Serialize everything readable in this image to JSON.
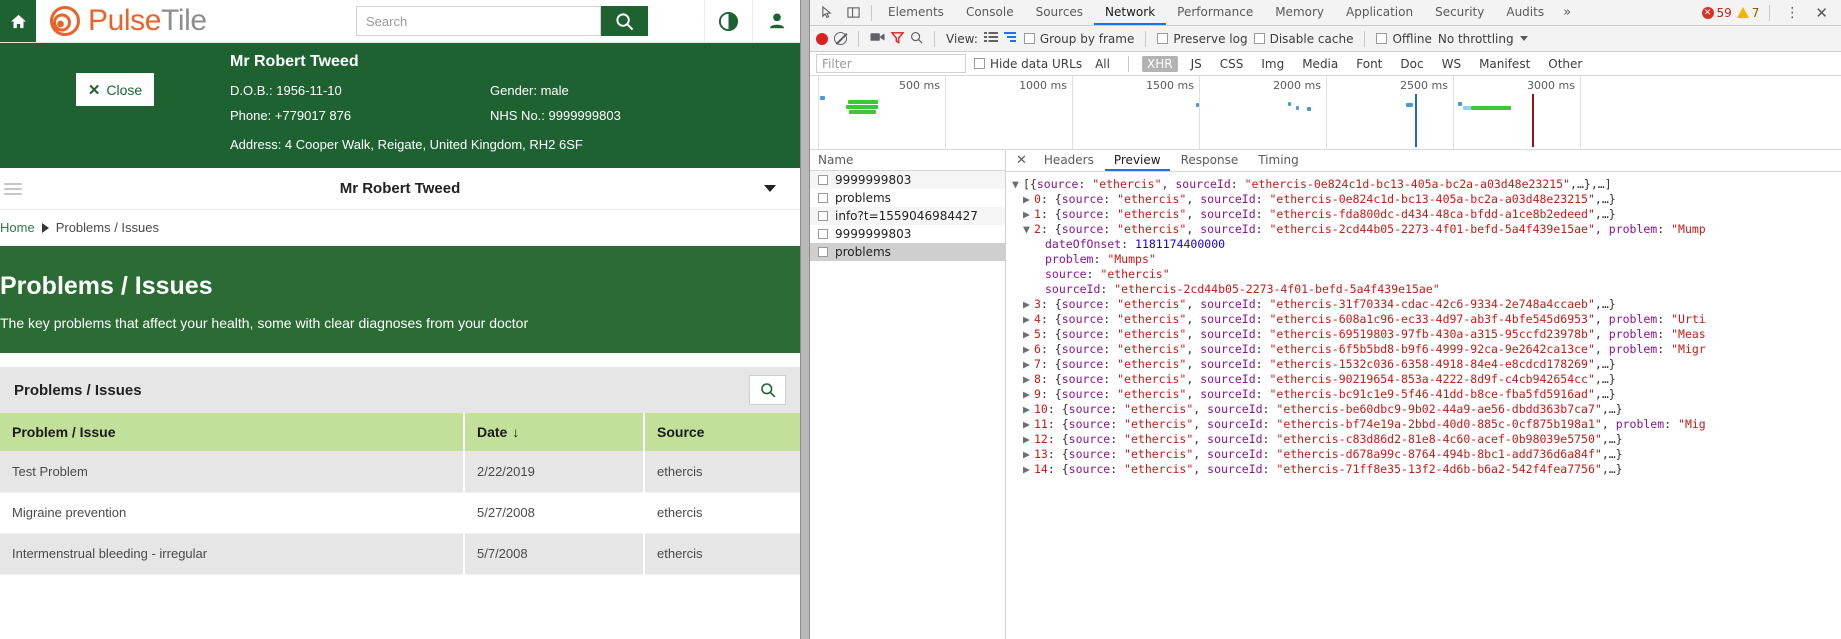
{
  "app": {
    "brand": {
      "pulse": "Pulse",
      "tile": "Tile",
      "home_icon": "home-icon",
      "logo_icon": "pulsetile-logo-icon"
    },
    "search": {
      "placeholder": "Search",
      "value": "",
      "button_icon": "search-icon"
    },
    "topbar_icons": [
      {
        "name": "contrast-icon",
        "glyph": "◑"
      },
      {
        "name": "user-icon",
        "glyph": "person"
      }
    ],
    "patient": {
      "close_label": "Close",
      "close_icon": "close-x-icon",
      "name": "Mr Robert Tweed",
      "dob_label": "D.O.B.: 1956-11-10",
      "phone_label": "Phone: +779017 876",
      "gender_label": "Gender: male",
      "nhs_label": "NHS No.: 9999999803",
      "address_label": "Address: 4 Cooper Walk, Reigate, United Kingdom, RH2 6SF"
    },
    "subbar": {
      "title": "Mr Robert Tweed",
      "menu_icon": "hamburger-icon",
      "caret_icon": "chevron-down-icon"
    },
    "breadcrumb": {
      "home": "Home",
      "current": "Problems / Issues"
    },
    "hero": {
      "title": "Problems / Issues",
      "subtitle": "The key problems that affect your health, some with clear diagnoses from your doctor"
    },
    "panel": {
      "title": "Problems / Issues",
      "search_icon": "search-icon"
    },
    "table": {
      "columns": [
        "Problem / Issue",
        "Date",
        "Source"
      ],
      "sort_column": "Date",
      "sort_arrow": "↓",
      "rows": [
        {
          "problem": "Test Problem",
          "date": "2/22/2019",
          "source": "ethercis"
        },
        {
          "problem": "Migraine prevention",
          "date": "5/27/2008",
          "source": "ethercis"
        },
        {
          "problem": "Intermenstrual bleeding - irregular",
          "date": "5/7/2008",
          "source": "ethercis"
        }
      ]
    }
  },
  "devtools": {
    "tabs": [
      {
        "label": "Elements",
        "active": false
      },
      {
        "label": "Console",
        "active": false
      },
      {
        "label": "Sources",
        "active": false
      },
      {
        "label": "Network",
        "active": true
      },
      {
        "label": "Performance",
        "active": false
      },
      {
        "label": "Memory",
        "active": false
      },
      {
        "label": "Application",
        "active": false
      },
      {
        "label": "Security",
        "active": false
      },
      {
        "label": "Audits",
        "active": false
      }
    ],
    "more_tabs": "»",
    "inspect_icon": "inspect-cursor-icon",
    "device_icon": "device-toolbar-icon",
    "error_count": "59",
    "warning_count": "7",
    "kebab": "⋮",
    "close": "✕",
    "toolbar": {
      "record_icon": "record-button",
      "clear_icon": "clear-button",
      "camera_icon": "capture-screenshots-icon",
      "filter_icon": "filter-icon",
      "search_icon": "search-icon",
      "view_label": "View:",
      "list_icon": "list-view-icon",
      "waterfall_icon": "waterfall-view-icon",
      "group_by_frame": "Group by frame",
      "preserve_log": "Preserve log",
      "disable_cache": "Disable cache",
      "offline": "Offline",
      "throttling": "No throttling"
    },
    "filterbar": {
      "placeholder": "Filter",
      "value": "",
      "hide_data_urls": "Hide data URLs",
      "types": [
        {
          "label": "All",
          "active": false
        },
        {
          "label": "XHR",
          "active": true
        },
        {
          "label": "JS",
          "active": false
        },
        {
          "label": "CSS",
          "active": false
        },
        {
          "label": "Img",
          "active": false
        },
        {
          "label": "Media",
          "active": false
        },
        {
          "label": "Font",
          "active": false
        },
        {
          "label": "Doc",
          "active": false
        },
        {
          "label": "WS",
          "active": false
        },
        {
          "label": "Manifest",
          "active": false
        },
        {
          "label": "Other",
          "active": false
        }
      ]
    },
    "overview": {
      "ticks": [
        "500 ms",
        "1000 ms",
        "1500 ms",
        "2000 ms",
        "2500 ms",
        "3000 ms"
      ]
    },
    "requests": {
      "column_header": "Name",
      "items": [
        {
          "name": "9999999803",
          "selected": false
        },
        {
          "name": "problems",
          "selected": false
        },
        {
          "name": "info?t=1559046984427",
          "selected": false
        },
        {
          "name": "9999999803",
          "selected": false
        },
        {
          "name": "problems",
          "selected": true
        }
      ]
    },
    "detail": {
      "close_icon": "close-icon",
      "tabs": [
        {
          "label": "Headers",
          "active": false
        },
        {
          "label": "Preview",
          "active": true
        },
        {
          "label": "Response",
          "active": false
        },
        {
          "label": "Timing",
          "active": false
        }
      ],
      "preview_lines": [
        {
          "indent": 0,
          "twisty": "▼",
          "prefix": "[{",
          "key": "source",
          "value": "\"ethercis\"",
          "rest": ", sourceId: \"ethercis-0e824c1d-bc13-405a-bc2a-a03d48e23215\",…},…]"
        },
        {
          "indent": 1,
          "twisty": "▶",
          "index": "0",
          "text": ": {source: \"ethercis\", sourceId: \"ethercis-0e824c1d-bc13-405a-bc2a-a03d48e23215\",…}"
        },
        {
          "indent": 1,
          "twisty": "▶",
          "index": "1",
          "text": ": {source: \"ethercis\", sourceId: \"ethercis-fda800dc-d434-48ca-bfdd-a1ce8b2edeed\",…}"
        },
        {
          "indent": 1,
          "twisty": "▼",
          "index": "2",
          "text": ": {source: \"ethercis\", sourceId: \"ethercis-2cd44b05-2273-4f01-befd-5a4f439e15ae\", problem: \"Mump"
        },
        {
          "indent": 2,
          "key": "dateOfOnset",
          "num": "1181174400000"
        },
        {
          "indent": 2,
          "key": "problem",
          "str": "\"Mumps\""
        },
        {
          "indent": 2,
          "key": "source",
          "str": "\"ethercis\""
        },
        {
          "indent": 2,
          "key": "sourceId",
          "str": "\"ethercis-2cd44b05-2273-4f01-befd-5a4f439e15ae\""
        },
        {
          "indent": 1,
          "twisty": "▶",
          "index": "3",
          "text": ": {source: \"ethercis\", sourceId: \"ethercis-31f70334-cdac-42c6-9334-2e748a4ccaeb\",…}"
        },
        {
          "indent": 1,
          "twisty": "▶",
          "index": "4",
          "text": ": {source: \"ethercis\", sourceId: \"ethercis-608a1c96-ec33-4d97-ab3f-4bfe545d6953\", problem: \"Urti"
        },
        {
          "indent": 1,
          "twisty": "▶",
          "index": "5",
          "text": ": {source: \"ethercis\", sourceId: \"ethercis-69519803-97fb-430a-a315-95ccfd23978b\", problem: \"Meas"
        },
        {
          "indent": 1,
          "twisty": "▶",
          "index": "6",
          "text": ": {source: \"ethercis\", sourceId: \"ethercis-6f5b5bd8-b9f6-4999-92ca-9e2642ca13ce\", problem: \"Migr"
        },
        {
          "indent": 1,
          "twisty": "▶",
          "index": "7",
          "text": ": {source: \"ethercis\", sourceId: \"ethercis-1532c036-6358-4918-84e4-e8cdcd178269\",…}"
        },
        {
          "indent": 1,
          "twisty": "▶",
          "index": "8",
          "text": ": {source: \"ethercis\", sourceId: \"ethercis-90219654-853a-4222-8d9f-c4cb942654cc\",…}"
        },
        {
          "indent": 1,
          "twisty": "▶",
          "index": "9",
          "text": ": {source: \"ethercis\", sourceId: \"ethercis-bc91c1e9-5f46-41dd-b8ce-fba5fd5916ad\",…}"
        },
        {
          "indent": 1,
          "twisty": "▶",
          "index": "10",
          "text": ": {source: \"ethercis\", sourceId: \"ethercis-be60dbc9-9b02-44a9-ae56-dbdd363b7ca7\",…}"
        },
        {
          "indent": 1,
          "twisty": "▶",
          "index": "11",
          "text": ": {source: \"ethercis\", sourceId: \"ethercis-bf74e19a-2bbd-40d0-885c-0cf875b198a1\", problem: \"Mig"
        },
        {
          "indent": 1,
          "twisty": "▶",
          "index": "12",
          "text": ": {source: \"ethercis\", sourceId: \"ethercis-c83d86d2-81e8-4c60-acef-0b98039e5750\",…}"
        },
        {
          "indent": 1,
          "twisty": "▶",
          "index": "13",
          "text": ": {source: \"ethercis\", sourceId: \"ethercis-d678a99c-8764-494b-8bc1-add736d6a84f\",…}"
        },
        {
          "indent": 1,
          "twisty": "▶",
          "index": "14",
          "text": ": {source: \"ethercis\", sourceId: \"ethercis-71ff8e35-13f2-4d6b-b6a2-542f4fea7756\",…}"
        }
      ]
    }
  },
  "colors": {
    "brand_green": "#1f6232",
    "hero_green": "#2b6b34",
    "table_header_green": "#c2e09a",
    "orange": "#e8622a",
    "devtools_accent": "#1a73e8"
  }
}
